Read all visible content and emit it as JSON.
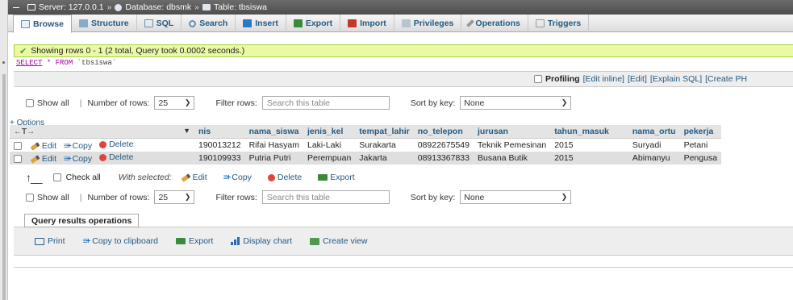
{
  "breadcrumb": {
    "server": "Server: 127.0.0.1",
    "database": "Database: dbsmk",
    "table": "Table: tbsiswa",
    "separator": "»"
  },
  "tabs": [
    {
      "label": "Browse",
      "icon": "browse-icon",
      "active": true
    },
    {
      "label": "Structure",
      "icon": "structure-icon"
    },
    {
      "label": "SQL",
      "icon": "sql-icon"
    },
    {
      "label": "Search",
      "icon": "search-icon"
    },
    {
      "label": "Insert",
      "icon": "insert-icon"
    },
    {
      "label": "Export",
      "icon": "export-icon"
    },
    {
      "label": "Import",
      "icon": "import-icon"
    },
    {
      "label": "Privileges",
      "icon": "privileges-icon"
    },
    {
      "label": "Operations",
      "icon": "operations-icon"
    },
    {
      "label": "Triggers",
      "icon": "triggers-icon"
    }
  ],
  "message": {
    "text": "Showing rows 0 - 1 (2 total, Query took 0.0002 seconds.)"
  },
  "sql": {
    "select": "SELECT",
    "star": "*",
    "from": "FROM",
    "table": "`tbsiswa`"
  },
  "profiling": {
    "label": "Profiling",
    "edit_inline": "[Edit inline]",
    "edit": "[Edit]",
    "explain": "[Explain SQL]",
    "create": "[Create PH"
  },
  "nav": {
    "show_all": "Show all",
    "pipe": "|",
    "number_of_rows": "Number of rows:",
    "rows_value": "25",
    "filter_rows": "Filter rows:",
    "search_placeholder": "Search this table",
    "sort_by_key": "Sort by key:",
    "sort_value": "None"
  },
  "options_link": "+ Options",
  "table": {
    "headers": [
      "nis",
      "nama_siswa",
      "jenis_kel",
      "tempat_lahir",
      "no_telepon",
      "jurusan",
      "tahun_masuk",
      "nama_ortu",
      "pekerja"
    ],
    "actions": {
      "edit": "Edit",
      "copy": "Copy",
      "delete": "Delete"
    },
    "rows": [
      [
        "190013212",
        "Rifai Hasyam",
        "Laki-Laki",
        "Surakarta",
        "08922675549",
        "Teknik Pemesinan",
        "2015",
        "Suryadi",
        "Petani"
      ],
      [
        "190109933",
        "Putria Putri",
        "Perempuan",
        "Jakarta",
        "08913367833",
        "Busana Butik",
        "2015",
        "Abimanyu",
        "Pengusa"
      ]
    ]
  },
  "bulk": {
    "check_all": "Check all",
    "with_selected": "With selected:",
    "edit": "Edit",
    "copy": "Copy",
    "delete": "Delete",
    "export": "Export"
  },
  "query_results": {
    "title": "Query results operations",
    "print": "Print",
    "copy_clipboard": "Copy to clipboard",
    "export": "Export",
    "display_chart": "Display chart",
    "create_view": "Create view"
  }
}
